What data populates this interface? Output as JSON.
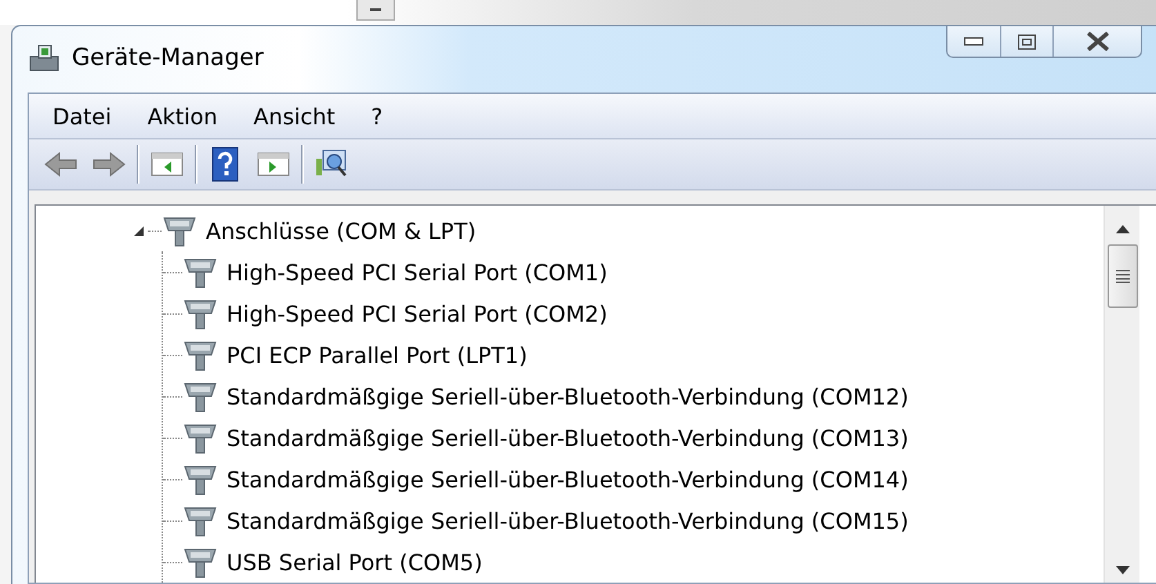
{
  "window": {
    "title": "Geräte-Manager"
  },
  "menu": [
    {
      "label": "Datei"
    },
    {
      "label": "Aktion"
    },
    {
      "label": "Ansicht"
    },
    {
      "label": "?"
    }
  ],
  "toolbar": [
    {
      "kind": "back"
    },
    {
      "kind": "forward"
    },
    {
      "kind": "separator"
    },
    {
      "kind": "pane-left"
    },
    {
      "kind": "separator"
    },
    {
      "kind": "help"
    },
    {
      "kind": "pane-right"
    },
    {
      "kind": "separator"
    },
    {
      "kind": "scan"
    }
  ],
  "tree": [
    {
      "label": "Anschlüsse (COM & LPT)",
      "expanded": true,
      "children": [
        {
          "label": "High-Speed PCI Serial Port (COM1)"
        },
        {
          "label": "High-Speed PCI Serial Port (COM2)"
        },
        {
          "label": "PCI ECP Parallel Port (LPT1)"
        },
        {
          "label": "Standardmäßgige Seriell-über-Bluetooth-Verbindung (COM12)"
        },
        {
          "label": "Standardmäßgige Seriell-über-Bluetooth-Verbindung (COM13)"
        },
        {
          "label": "Standardmäßgige Seriell-über-Bluetooth-Verbindung (COM14)"
        },
        {
          "label": "Standardmäßgige Seriell-über-Bluetooth-Verbindung (COM15)"
        },
        {
          "label": "USB Serial Port (COM5)"
        }
      ]
    }
  ]
}
